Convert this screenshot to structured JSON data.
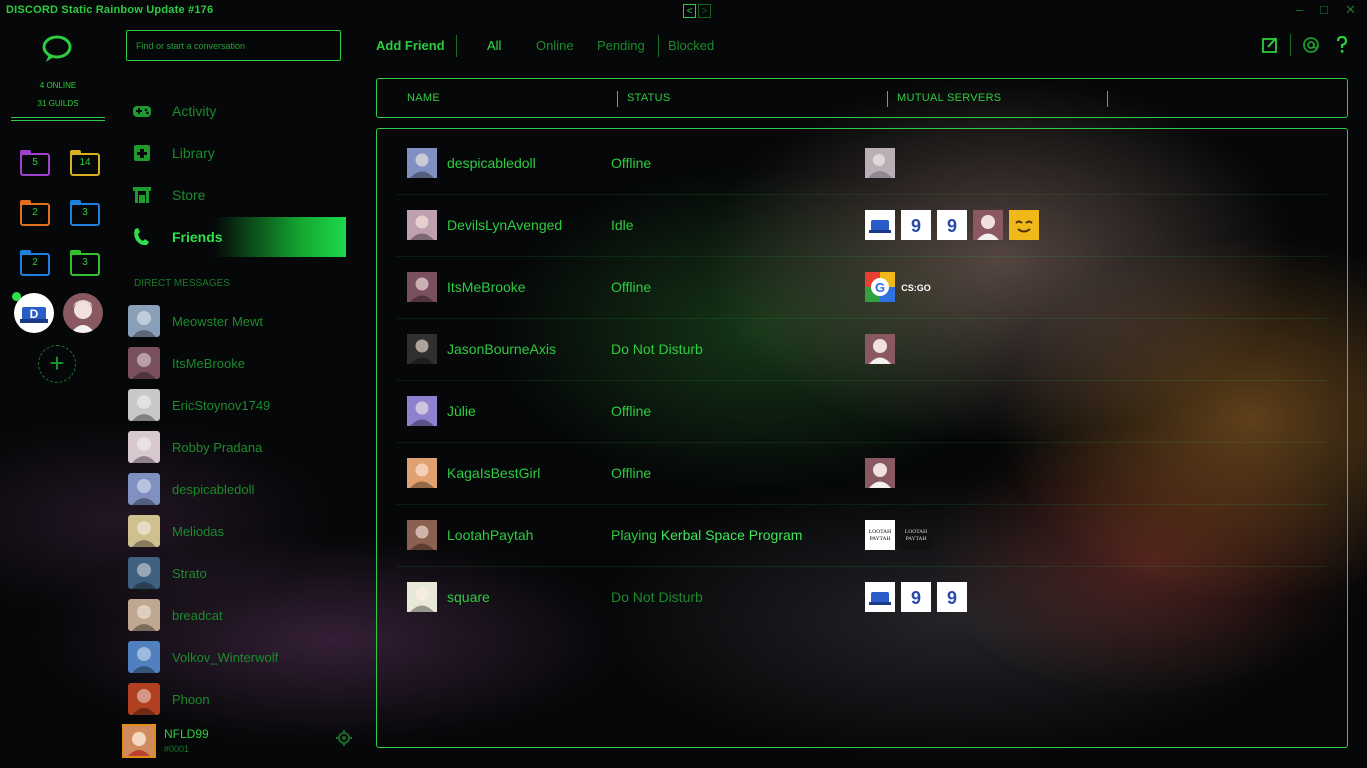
{
  "window": {
    "title": "DISCORD Static Rainbow Update #176",
    "nav_back": "<",
    "nav_forward": ">",
    "minimize": "–",
    "maximize": "□",
    "close": "✕"
  },
  "guilds": {
    "online": "4 ONLINE",
    "count": "31 GUILDS",
    "folders": [
      {
        "num": "5",
        "color": "#a040d0"
      },
      {
        "num": "14",
        "color": "#d8b020"
      },
      {
        "num": "2",
        "color": "#e07020"
      },
      {
        "num": "3",
        "color": "#2080e0"
      },
      {
        "num": "2",
        "color": "#2080e0"
      },
      {
        "num": "3",
        "color": "#30c030"
      }
    ],
    "add_label": "+"
  },
  "search": {
    "placeholder": "Find or start a conversation"
  },
  "nav": [
    {
      "label": "Activity",
      "icon": "gamepad-icon"
    },
    {
      "label": "Library",
      "icon": "library-icon"
    },
    {
      "label": "Store",
      "icon": "store-icon"
    },
    {
      "label": "Friends",
      "icon": "friends-icon"
    }
  ],
  "dms": {
    "header": "DIRECT MESSAGES",
    "items": [
      {
        "name": "Meowster Mewt",
        "color": "#8aa0b8"
      },
      {
        "name": "ItsMeBrooke",
        "color": "#7a5060"
      },
      {
        "name": "EricStoynov1749",
        "color": "#c8c8c8"
      },
      {
        "name": "Robby Pradana",
        "color": "#d8c8d0"
      },
      {
        "name": "despicabledoll",
        "color": "#8090c0"
      },
      {
        "name": "Meliodas",
        "color": "#d0c090"
      },
      {
        "name": "Strato",
        "color": "#406080"
      },
      {
        "name": "breadcat",
        "color": "#c0a890"
      },
      {
        "name": "Volkov_Winterwolf",
        "color": "#5080c0"
      },
      {
        "name": "Phoon",
        "color": "#b04020"
      }
    ]
  },
  "user": {
    "name": "NFLD99",
    "tag": "#0001"
  },
  "tabs": {
    "add_friend": "Add Friend",
    "items": [
      "All",
      "Online",
      "Pending",
      "Blocked"
    ]
  },
  "columns": {
    "name": "NAME",
    "status": "STATUS",
    "mutual": "MUTUAL SERVERS"
  },
  "friends": [
    {
      "name": "despicabledoll",
      "status": "Offline",
      "status_dim": false,
      "game": "",
      "servers": [
        "photo-gray"
      ]
    },
    {
      "name": "DevilsLynAvenged",
      "status": "Idle",
      "status_dim": false,
      "game": "",
      "servers": [
        "blue-logo",
        "g9-logo",
        "g9-logo",
        "anime",
        "smiley"
      ]
    },
    {
      "name": "ItsMeBrooke",
      "status": "Offline",
      "status_dim": false,
      "game": "",
      "servers": [
        "google-logo",
        "csgo-logo"
      ]
    },
    {
      "name": "JasonBourneAxis",
      "status": "Do Not Disturb",
      "status_dim": false,
      "game": "",
      "servers": [
        "anime"
      ]
    },
    {
      "name": "Jùlie",
      "status": "Offline",
      "status_dim": false,
      "game": "",
      "servers": []
    },
    {
      "name": "KagaIsBestGirl",
      "status": "Offline",
      "status_dim": false,
      "game": "",
      "servers": [
        "anime"
      ]
    },
    {
      "name": "LootahPaytah",
      "status": "Playing ",
      "status_dim": false,
      "game": "Kerbal Space Program",
      "servers": [
        "lootah-white",
        "lootah-black"
      ]
    },
    {
      "name": "square",
      "status": "Do Not Disturb",
      "status_dim": true,
      "game": "",
      "servers": [
        "blue-logo",
        "g9-logo",
        "g9-logo"
      ]
    }
  ],
  "server_text": {
    "csgo": "CS:GO",
    "g": "G",
    "nine": "9",
    "lootah": "LOOTAH PAYTAH"
  }
}
